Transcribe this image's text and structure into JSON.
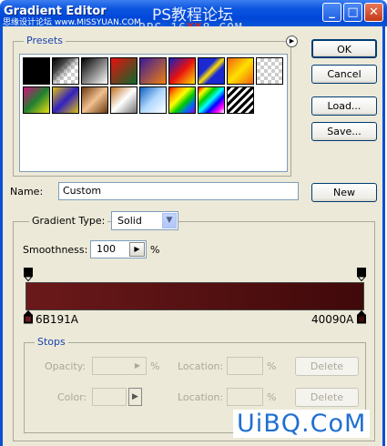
{
  "window": {
    "title": "Gradient Editor",
    "watermark_site": "思缘设计论坛 www.MISSYUAN.COM",
    "watermark_cn": "PS教程论坛",
    "watermark_bbs_prefix": "BBS.16",
    "watermark_bbs_red": "XX",
    "watermark_bbs_suffix": "8.COM"
  },
  "presets": {
    "legend": "Presets",
    "menu_icon": "right-arrow-circle-icon"
  },
  "buttons": {
    "ok": "OK",
    "cancel": "Cancel",
    "load": "Load...",
    "save": "Save...",
    "new": "New"
  },
  "name_field": {
    "label": "Name:",
    "value": "Custom"
  },
  "gradient": {
    "type_label": "Gradient Type:",
    "type_value": "Solid",
    "smoothness_label": "Smoothness:",
    "smoothness_value": "100",
    "smoothness_unit": "%",
    "left_color": "6B191A",
    "right_color": "40090A",
    "left_hex": "#6B191A",
    "right_hex": "#40090A"
  },
  "stops": {
    "legend": "Stops",
    "opacity_label": "Opacity:",
    "opacity_unit": "%",
    "location_label": "Location:",
    "location_unit": "%",
    "color_label": "Color:",
    "delete_label": "Delete"
  },
  "brand": {
    "logo_text": "UiBQ.CoM"
  }
}
